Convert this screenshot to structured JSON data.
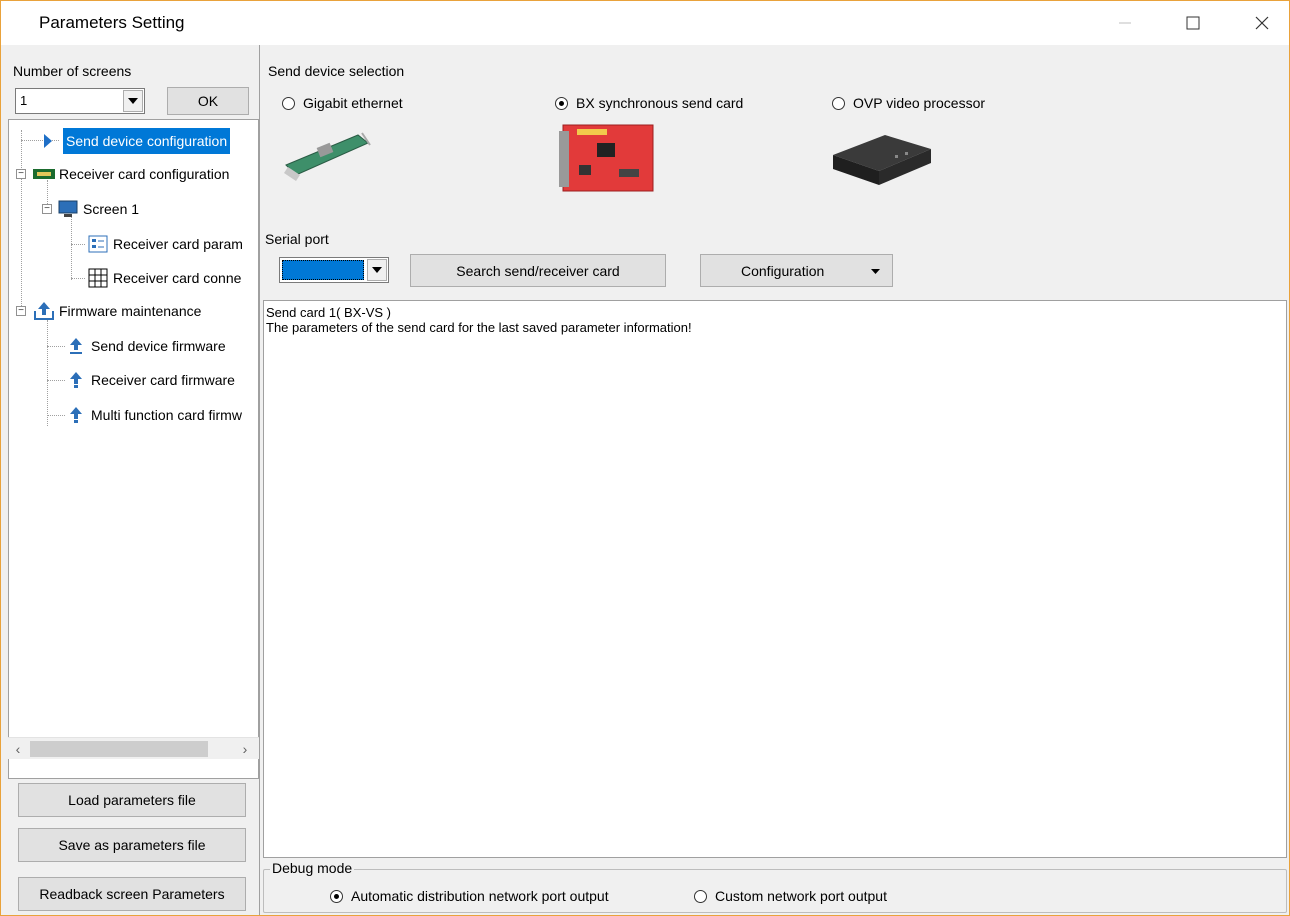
{
  "window": {
    "title": "Parameters Setting",
    "accent_color": "#e9a23b",
    "selection_color": "#0078d7"
  },
  "left": {
    "screens_label": "Number of screens",
    "screens_value": "1",
    "ok_label": "OK",
    "tree": {
      "send_device": "Send device configuration",
      "receiver_config": "Receiver card configuration",
      "screen1": "Screen 1",
      "receiver_param": "Receiver card param",
      "receiver_conn": "Receiver card conne",
      "firmware": "Firmware maintenance",
      "send_fw": "Send device firmware",
      "receiver_fw": "Receiver card firmware",
      "multi_fw": "Multi function card firmw"
    },
    "buttons": {
      "load": "Load parameters file",
      "save": "Save as parameters file",
      "readback": "Readback screen Parameters"
    }
  },
  "right": {
    "send_device_label": "Send device selection",
    "devices": [
      {
        "label": "Gigabit ethernet",
        "selected": false
      },
      {
        "label": "BX synchronous send card",
        "selected": true
      },
      {
        "label": "OVP video processor",
        "selected": false
      }
    ],
    "serial_label": "Serial port",
    "search_label": "Search send/receiver card",
    "config_label": "Configuration",
    "log_lines": [
      "Send card 1( BX-VS )",
      "The parameters of the send card for the last saved parameter information!"
    ],
    "debug": {
      "label": "Debug mode",
      "options": [
        {
          "label": "Automatic distribution network port output",
          "selected": true
        },
        {
          "label": "Custom network port output",
          "selected": false
        }
      ]
    }
  }
}
